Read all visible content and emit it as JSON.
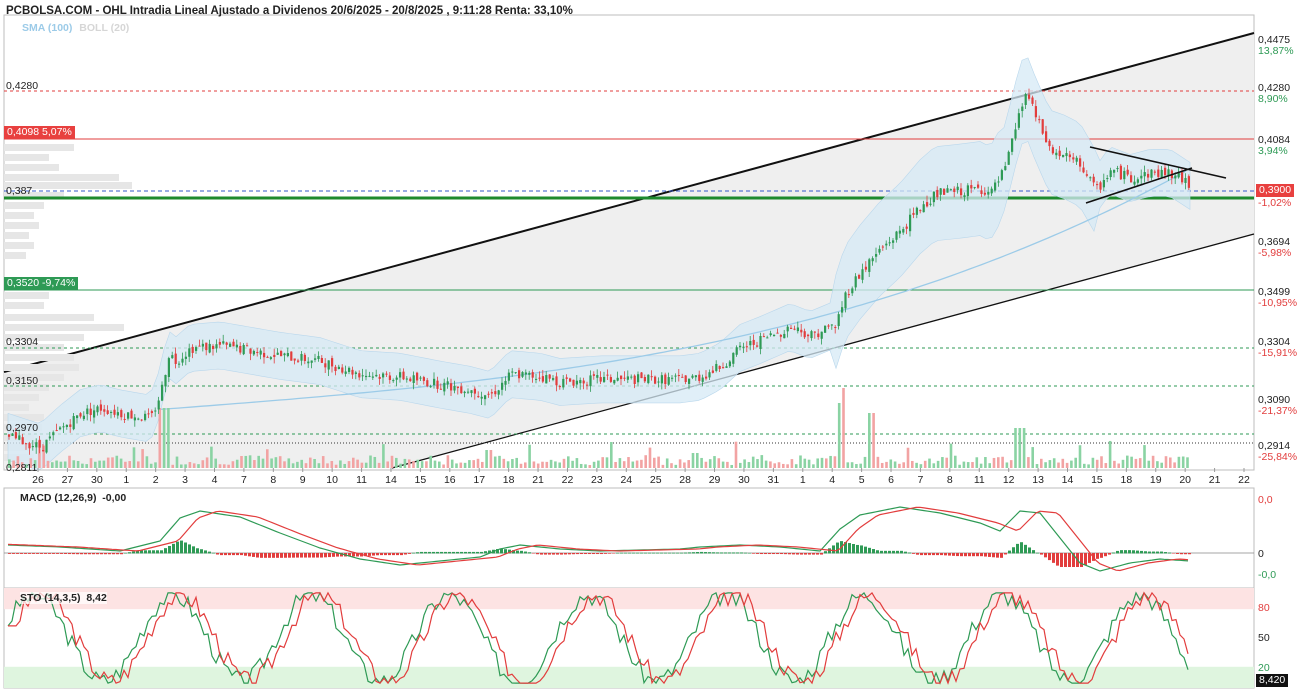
{
  "header": {
    "title": "PCBOLSA.COM - OHL Intradia Lineal Ajustado a Dividenos 20/6/2025 - 20/8/2025 , 9:11:28 Renta: 33,10%",
    "sma_label": "SMA (100)",
    "boll_label": "BOLL (20)"
  },
  "left_labels": {
    "l4280": "0,4280",
    "l4098": "0,4098",
    "l4098_pct": "5,07%",
    "l387": "0,387",
    "l3520": "0,3520",
    "l3520_pct": "-9,74%",
    "l3304": "0,3304",
    "l3150": "0,3150",
    "l2970": "0,2970",
    "l2811": "0,2811"
  },
  "right_axis": [
    {
      "price": "0,4475",
      "pct": "13,87%",
      "pct_color": "#2e9a55"
    },
    {
      "price": "0,4280",
      "pct": "8,90%",
      "pct_color": "#2e9a55"
    },
    {
      "price": "0,4084",
      "pct": "3,94%",
      "pct_color": "#2e9a55"
    },
    {
      "price": "0,3900",
      "pct": "-1,02%",
      "pct_color": "#e23d3d"
    },
    {
      "price": "0,3694",
      "pct": "-5,98%",
      "pct_color": "#e23d3d"
    },
    {
      "price": "0,3499",
      "pct": "-10,95%",
      "pct_color": "#e23d3d"
    },
    {
      "price": "0,3304",
      "pct": "-15,91%",
      "pct_color": "#e23d3d"
    },
    {
      "price": "0,3090",
      "pct": "-21,37%",
      "pct_color": "#e23d3d"
    },
    {
      "price": "0,2914",
      "pct": "-25,84%",
      "pct_color": "#e23d3d"
    }
  ],
  "last_price": "0,3900",
  "x_labels": [
    "26",
    "27",
    "30",
    "1",
    "2",
    "3",
    "4",
    "7",
    "8",
    "9",
    "10",
    "11",
    "14",
    "15",
    "16",
    "17",
    "18",
    "21",
    "22",
    "23",
    "24",
    "25",
    "28",
    "29",
    "30",
    "31",
    "1",
    "4",
    "5",
    "6",
    "7",
    "8",
    "11",
    "12",
    "13",
    "14",
    "15",
    "18",
    "19",
    "20",
    "21",
    "22"
  ],
  "macd": {
    "title": "MACD (12,26,9)",
    "value": "-0,00",
    "axis_top": "0,0",
    "axis_mid": "0",
    "axis_bot": "-0,0"
  },
  "sto": {
    "title": "STO (14,3,5)",
    "value": "8,42",
    "axis_80": "80",
    "axis_50": "50",
    "axis_20": "20",
    "last": "8,420"
  },
  "colors": {
    "up": "#2e9a55",
    "down": "#e23d3d",
    "channel": "#111111",
    "sma": "#9ccbe8",
    "boll_fill": "#d6e9f6",
    "support": "#1e8a2e",
    "price_box": "#e8403f"
  },
  "chart_data": {
    "type": "candlestick",
    "title": "PCBOLSA.COM - OHL Intradia Lineal Ajustado a Dividenos 20/6/2025 - 20/8/2025 , 9:11:28 Renta: 33,10%",
    "x": [
      "26",
      "27",
      "30",
      "1",
      "2",
      "3",
      "4",
      "7",
      "8",
      "9",
      "10",
      "11",
      "14",
      "15",
      "16",
      "17",
      "18",
      "21",
      "22",
      "23",
      "24",
      "25",
      "28",
      "29",
      "30",
      "31",
      "1",
      "4",
      "5",
      "6",
      "7",
      "8",
      "11",
      "12",
      "13",
      "14",
      "15",
      "18",
      "19",
      "20",
      "21",
      "22"
    ],
    "close": [
      0.2955,
      0.2985,
      0.3035,
      0.302,
      0.3,
      0.323,
      0.3285,
      0.328,
      0.3255,
      0.3225,
      0.321,
      0.3175,
      0.3165,
      0.314,
      0.311,
      0.3095,
      0.3175,
      0.315,
      0.315,
      0.3145,
      0.3155,
      0.316,
      0.316,
      0.32,
      0.326,
      0.331,
      0.329,
      0.334,
      0.359,
      0.371,
      0.381,
      0.387,
      0.388,
      0.393,
      0.415,
      0.401,
      0.393,
      0.396,
      0.395,
      0.392,
      0.39
    ],
    "ylim": [
      0.2811,
      0.4475
    ],
    "horizontal_levels": [
      0.428,
      0.4098,
      0.387,
      0.352,
      0.3304,
      0.315,
      0.297
    ],
    "last": 0.39,
    "macd": {
      "title": "MACD (12,26,9)",
      "value": -0.0
    },
    "sto": {
      "title": "STO (14,3,5)",
      "value": 8.42,
      "levels": [
        80,
        50,
        20
      ]
    }
  }
}
